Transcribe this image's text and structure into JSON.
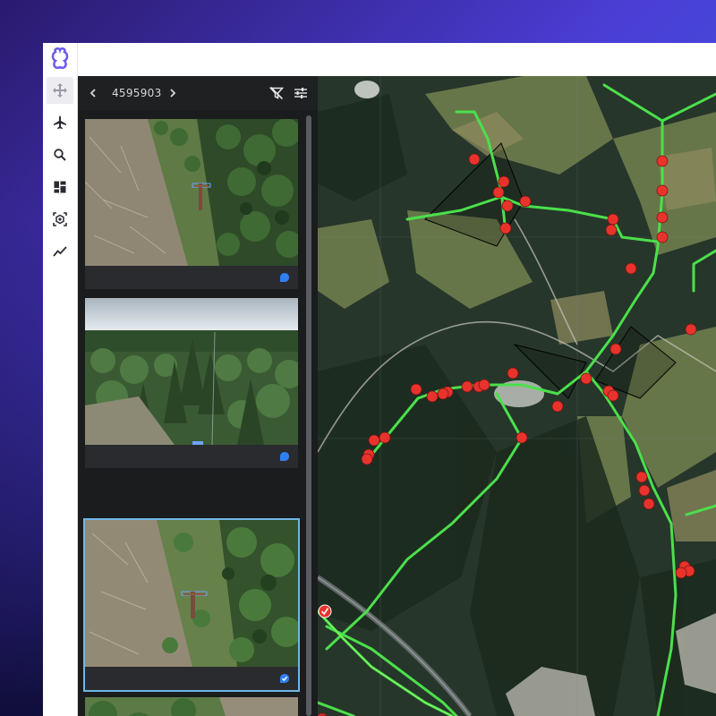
{
  "panel": {
    "image_id": "4595903"
  },
  "thumbnails": [
    {
      "scene": "aerial-down",
      "status": "pending",
      "selected": false
    },
    {
      "scene": "forest-corridor",
      "status": "pending",
      "selected": false
    },
    {
      "scene": "aerial-down",
      "status": "checked",
      "selected": true
    },
    {
      "scene": "aerial-partial",
      "status": "none",
      "selected": false
    }
  ],
  "colors": {
    "accent": "#6fb6e8",
    "status_dot": "#2f7ff0",
    "power_line": "#4be04b",
    "pole_marker": "#e8332d",
    "panel_bg": "#1b1c1e"
  },
  "icons": [
    "logo-icon",
    "move-icon",
    "plane-icon",
    "search-icon",
    "dashboard-icon",
    "inspect-icon",
    "chart-icon",
    "chevron-left-icon",
    "chevron-right-icon",
    "filter-off-icon",
    "sliders-icon"
  ]
}
